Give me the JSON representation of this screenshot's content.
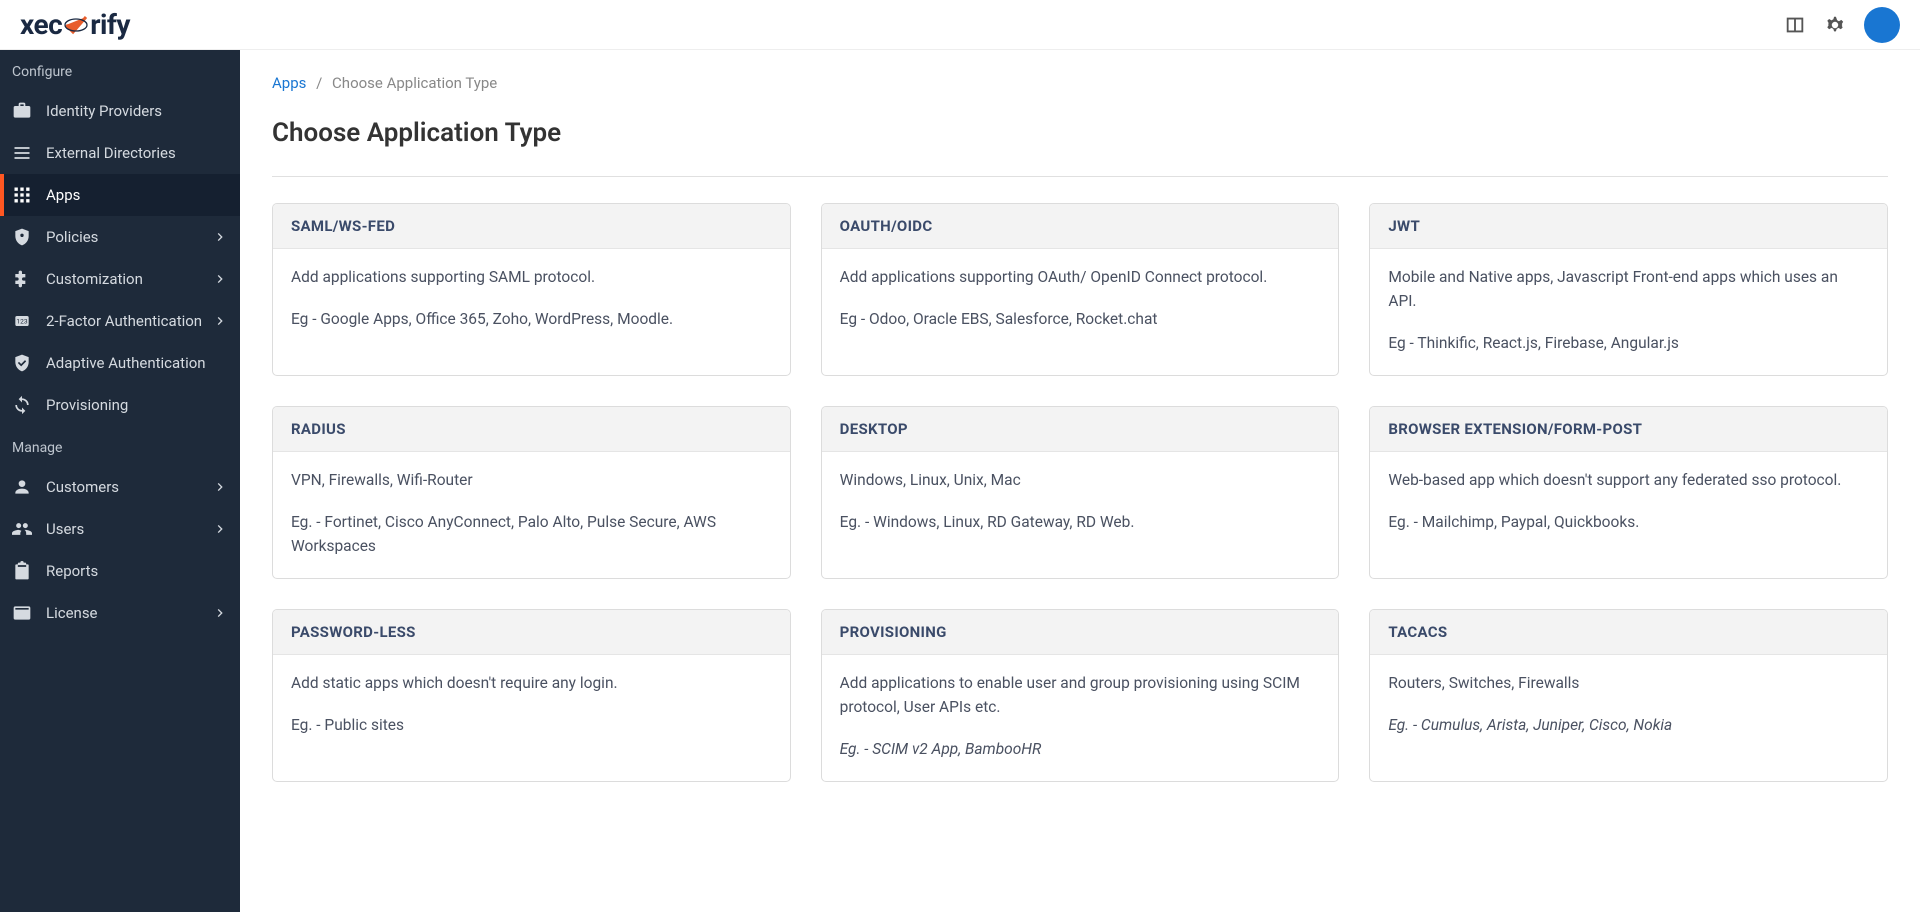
{
  "logo": {
    "pre": "xec",
    "post": "rify"
  },
  "sidebar": {
    "sections": [
      {
        "heading": "Configure",
        "items": [
          {
            "label": "Identity Providers",
            "icon": "briefcase",
            "chevron": false
          },
          {
            "label": "External Directories",
            "icon": "list",
            "chevron": false
          },
          {
            "label": "Apps",
            "icon": "grid",
            "chevron": false,
            "active": true
          },
          {
            "label": "Policies",
            "icon": "shield",
            "chevron": true
          },
          {
            "label": "Customization",
            "icon": "puzzle",
            "chevron": true
          },
          {
            "label": "2-Factor Authentication",
            "icon": "pin",
            "chevron": true
          },
          {
            "label": "Adaptive Authentication",
            "icon": "verified",
            "chevron": false
          },
          {
            "label": "Provisioning",
            "icon": "sync",
            "chevron": false
          }
        ]
      },
      {
        "heading": "Manage",
        "items": [
          {
            "label": "Customers",
            "icon": "person",
            "chevron": true
          },
          {
            "label": "Users",
            "icon": "people",
            "chevron": true
          },
          {
            "label": "Reports",
            "icon": "clipboard",
            "chevron": false
          },
          {
            "label": "License",
            "icon": "card",
            "chevron": true
          }
        ]
      }
    ]
  },
  "breadcrumb": {
    "link": "Apps",
    "current": "Choose Application Type"
  },
  "pageTitle": "Choose Application Type",
  "cards": [
    {
      "title": "SAML/WS-FED",
      "desc": "Add applications supporting SAML protocol.",
      "eg": "Eg - Google Apps, Office 365, Zoho, WordPress, Moodle."
    },
    {
      "title": "OAUTH/OIDC",
      "desc": "Add applications supporting OAuth/ OpenID Connect protocol.",
      "eg": "Eg - Odoo, Oracle EBS, Salesforce, Rocket.chat"
    },
    {
      "title": "JWT",
      "desc": "Mobile and Native apps, Javascript Front-end apps which uses an API.",
      "eg": "Eg - Thinkific, React.js, Firebase, Angular.js"
    },
    {
      "title": "RADIUS",
      "desc": "VPN, Firewalls, Wifi-Router",
      "eg": "Eg. - Fortinet, Cisco AnyConnect, Palo Alto, Pulse Secure, AWS Workspaces"
    },
    {
      "title": "DESKTOP",
      "desc": "Windows, Linux, Unix, Mac",
      "eg": "Eg. - Windows, Linux, RD Gateway, RD Web."
    },
    {
      "title": "BROWSER EXTENSION/FORM-POST",
      "desc": "Web-based app which doesn't support any federated sso protocol.",
      "eg": "Eg. - Mailchimp, Paypal, Quickbooks."
    },
    {
      "title": "PASSWORD-LESS",
      "desc": "Add static apps which doesn't require any login.",
      "eg": "Eg. - Public sites"
    },
    {
      "title": "PROVISIONING",
      "desc": "Add applications to enable user and group provisioning using SCIM protocol, User APIs etc.",
      "eg": "Eg. - SCIM v2 App, BambooHR",
      "italic": true
    },
    {
      "title": "TACACS",
      "desc": "Routers, Switches, Firewalls",
      "eg": "Eg. - Cumulus, Arista, Juniper, Cisco, Nokia",
      "italic": true
    }
  ]
}
